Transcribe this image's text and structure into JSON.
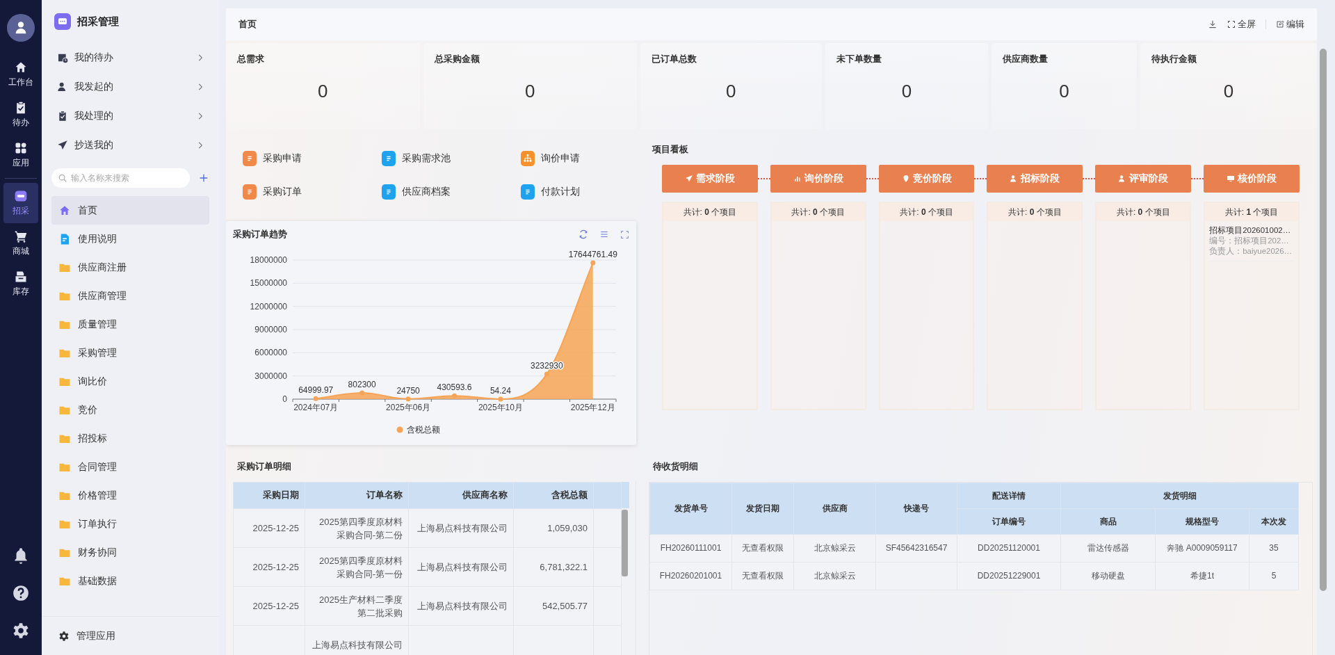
{
  "rail": {
    "items": [
      {
        "label": "工作台",
        "selected": false
      },
      {
        "label": "待办",
        "selected": false
      },
      {
        "label": "应用",
        "selected": false
      },
      {
        "label": "招采",
        "selected": true
      },
      {
        "label": "商城",
        "selected": false
      },
      {
        "label": "库存",
        "selected": false
      }
    ]
  },
  "sidenav": {
    "title": "招采管理",
    "shortcuts": [
      "我的待办",
      "我发起的",
      "我处理的",
      "抄送我的"
    ],
    "search": {
      "placeholder": "输入名称来搜索"
    },
    "items": [
      {
        "label": "首页",
        "kind": "home",
        "selected": true
      },
      {
        "label": "使用说明",
        "kind": "doc",
        "selected": false
      },
      {
        "label": "供应商注册",
        "kind": "folder",
        "selected": false
      },
      {
        "label": "供应商管理",
        "kind": "folder",
        "selected": false
      },
      {
        "label": "质量管理",
        "kind": "folder",
        "selected": false
      },
      {
        "label": "采购管理",
        "kind": "folder",
        "selected": false
      },
      {
        "label": "询比价",
        "kind": "folder",
        "selected": false
      },
      {
        "label": "竞价",
        "kind": "folder",
        "selected": false
      },
      {
        "label": "招投标",
        "kind": "folder",
        "selected": false
      },
      {
        "label": "合同管理",
        "kind": "folder",
        "selected": false
      },
      {
        "label": "价格管理",
        "kind": "folder",
        "selected": false
      },
      {
        "label": "订单执行",
        "kind": "folder",
        "selected": false
      },
      {
        "label": "财务协同",
        "kind": "folder",
        "selected": false
      },
      {
        "label": "基础数据",
        "kind": "folder",
        "selected": false
      }
    ],
    "footer": "管理应用"
  },
  "header": {
    "title": "首页",
    "actions": [
      "全屏",
      "编辑"
    ]
  },
  "stats": [
    {
      "label": "总需求",
      "value": "0"
    },
    {
      "label": "总采购金额",
      "value": "0"
    },
    {
      "label": "已订单总数",
      "value": "0"
    },
    {
      "label": "未下单数量",
      "value": "0"
    },
    {
      "label": "供应商数量",
      "value": "0"
    },
    {
      "label": "待执行金额",
      "value": "0"
    }
  ],
  "quick_links": [
    {
      "label": "采购申请",
      "color": "#f0894a"
    },
    {
      "label": "采购需求池",
      "color": "#1fa3ee"
    },
    {
      "label": "询价申请",
      "color": "#f5922f"
    },
    {
      "label": "采购订单",
      "color": "#f0894a"
    },
    {
      "label": "供应商档案",
      "color": "#1fa3ee"
    },
    {
      "label": "付款计划",
      "color": "#1fa3ee"
    }
  ],
  "chart": {
    "title": "采购订单趋势",
    "chart_data": {
      "type": "area",
      "categories": [
        "2024年07月",
        null,
        "2025年06月",
        null,
        "2025年10月",
        null,
        "2025年12月"
      ],
      "series": [
        {
          "name": "含税总额",
          "color": "#f7a456",
          "values": [
            64999.97,
            802300,
            24750,
            430593.6,
            54.24,
            3232930,
            17644761.49
          ]
        }
      ],
      "grid": true,
      "ylim": [
        0,
        18000000
      ],
      "yticks": [
        0,
        3000000,
        6000000,
        9000000,
        12000000,
        15000000,
        18000000
      ],
      "data_labels": true
    }
  },
  "kanban": {
    "title": "项目看板",
    "stages": [
      {
        "label": "需求阶段",
        "count": "共计: **0** 个项目"
      },
      {
        "label": "询价阶段",
        "count": "共计: **0** 个项目"
      },
      {
        "label": "竞价阶段",
        "count": "共计: **0** 个项目"
      },
      {
        "label": "招标阶段",
        "count": "共计: **0** 个项目"
      },
      {
        "label": "评审阶段",
        "count": "共计: **0** 个项目"
      },
      {
        "label": "核价阶段",
        "count": "共计: **1** 个项目",
        "cards": [
          {
            "title": "招标项目202601002…",
            "code": "编号：招标项目202…",
            "owner": "负责人：baiyue2026…"
          }
        ]
      }
    ]
  },
  "order_table": {
    "title": "采购订单明细",
    "columns": [
      "采购日期",
      "订单名称",
      "供应商名称",
      "含税总额"
    ],
    "rows": [
      {
        "date": "2025-12-25",
        "name": "2025第四季度原材料采购合同-第二份",
        "supplier": "上海易点科技有限公司",
        "amount": "1,059,030"
      },
      {
        "date": "2025-12-25",
        "name": "2025第四季度原材料采购合同-第一份",
        "supplier": "上海易点科技有限公司",
        "amount": "6,781,322.1"
      },
      {
        "date": "2025-12-25",
        "name": "2025生产材料二季度第二批采购",
        "supplier": "上海易点科技有限公司",
        "amount": "542,505.77"
      },
      {
        "name": "上海易点科技有限公司"
      }
    ]
  },
  "ship_table": {
    "title": "待收货明细",
    "columns": [
      {
        "label": "发货单号"
      },
      {
        "label": "发货日期"
      },
      {
        "label": "供应商"
      },
      {
        "label": "快递号"
      },
      {
        "label": "配送详情",
        "children": [
          {
            "label": "订单编号"
          }
        ]
      },
      {
        "label": "发货明细",
        "colspan": 3,
        "children": [
          {
            "label": "商品"
          },
          {
            "label": "规格型号"
          },
          {
            "label": "本次发"
          }
        ]
      }
    ],
    "rows": [
      [
        "FH20260111001",
        "无查看权限",
        "北京鲸采云",
        "SF45642316547",
        "DD20251120001",
        "雷达传感器",
        "奔驰 A0009059117",
        "35"
      ],
      [
        "FH20260201001",
        "无查看权限",
        "北京鲸采云",
        null,
        "DD20251229001",
        "移动硬盘",
        "希捷1t",
        "5"
      ]
    ]
  }
}
